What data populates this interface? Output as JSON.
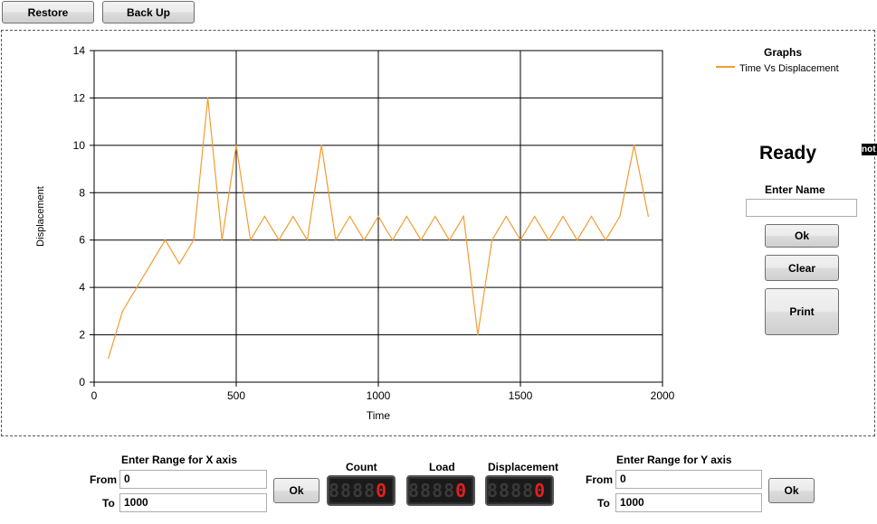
{
  "toolbar": {
    "restore_label": "Restore",
    "backup_label": "Back Up"
  },
  "legend": {
    "title": "Graphs",
    "series_label": "Time Vs Displacement",
    "color": "#f39c30"
  },
  "side_panel": {
    "status": "Ready",
    "badge": "not",
    "enter_name_label": "Enter Name",
    "name_value": "",
    "ok_label": "Ok",
    "clear_label": "Clear",
    "print_label": "Print"
  },
  "x_range": {
    "title": "Enter Range for X axis",
    "from_label": "From",
    "from_value": "0",
    "to_label": "To",
    "to_value": "1000",
    "ok_label": "Ok"
  },
  "y_range": {
    "title": "Enter Range for Y axis",
    "from_label": "From",
    "from_value": "0",
    "to_label": "To",
    "to_value": "1000",
    "ok_label": "Ok"
  },
  "meters": [
    {
      "label": "Count",
      "value": "0"
    },
    {
      "label": "Load",
      "value": "0"
    },
    {
      "label": "Displacement",
      "value": "0"
    }
  ],
  "chart_data": {
    "type": "line",
    "title": "",
    "xlabel": "Time",
    "ylabel": "Displacement",
    "xlim": [
      0,
      2000
    ],
    "ylim": [
      0,
      14
    ],
    "xticks": [
      0,
      500,
      1000,
      1500,
      2000
    ],
    "yticks": [
      0,
      2,
      4,
      6,
      8,
      10,
      12,
      14
    ],
    "grid": true,
    "legend_position": "top-right",
    "series": [
      {
        "name": "Time Vs Displacement",
        "color": "#f39c30",
        "x": [
          50,
          100,
          150,
          200,
          250,
          300,
          350,
          400,
          450,
          500,
          550,
          600,
          650,
          700,
          750,
          800,
          850,
          900,
          950,
          1000,
          1050,
          1100,
          1150,
          1200,
          1250,
          1300,
          1350,
          1400,
          1450,
          1500,
          1550,
          1600,
          1650,
          1700,
          1750,
          1800,
          1850,
          1900,
          1950
        ],
        "y": [
          1,
          3,
          4,
          5,
          6,
          5,
          6,
          12,
          6,
          10,
          6,
          7,
          6,
          7,
          6,
          10,
          6,
          7,
          6,
          7,
          6,
          7,
          6,
          7,
          6,
          7,
          2,
          6,
          7,
          6,
          7,
          6,
          7,
          6,
          7,
          6,
          7,
          10,
          7
        ]
      }
    ]
  }
}
